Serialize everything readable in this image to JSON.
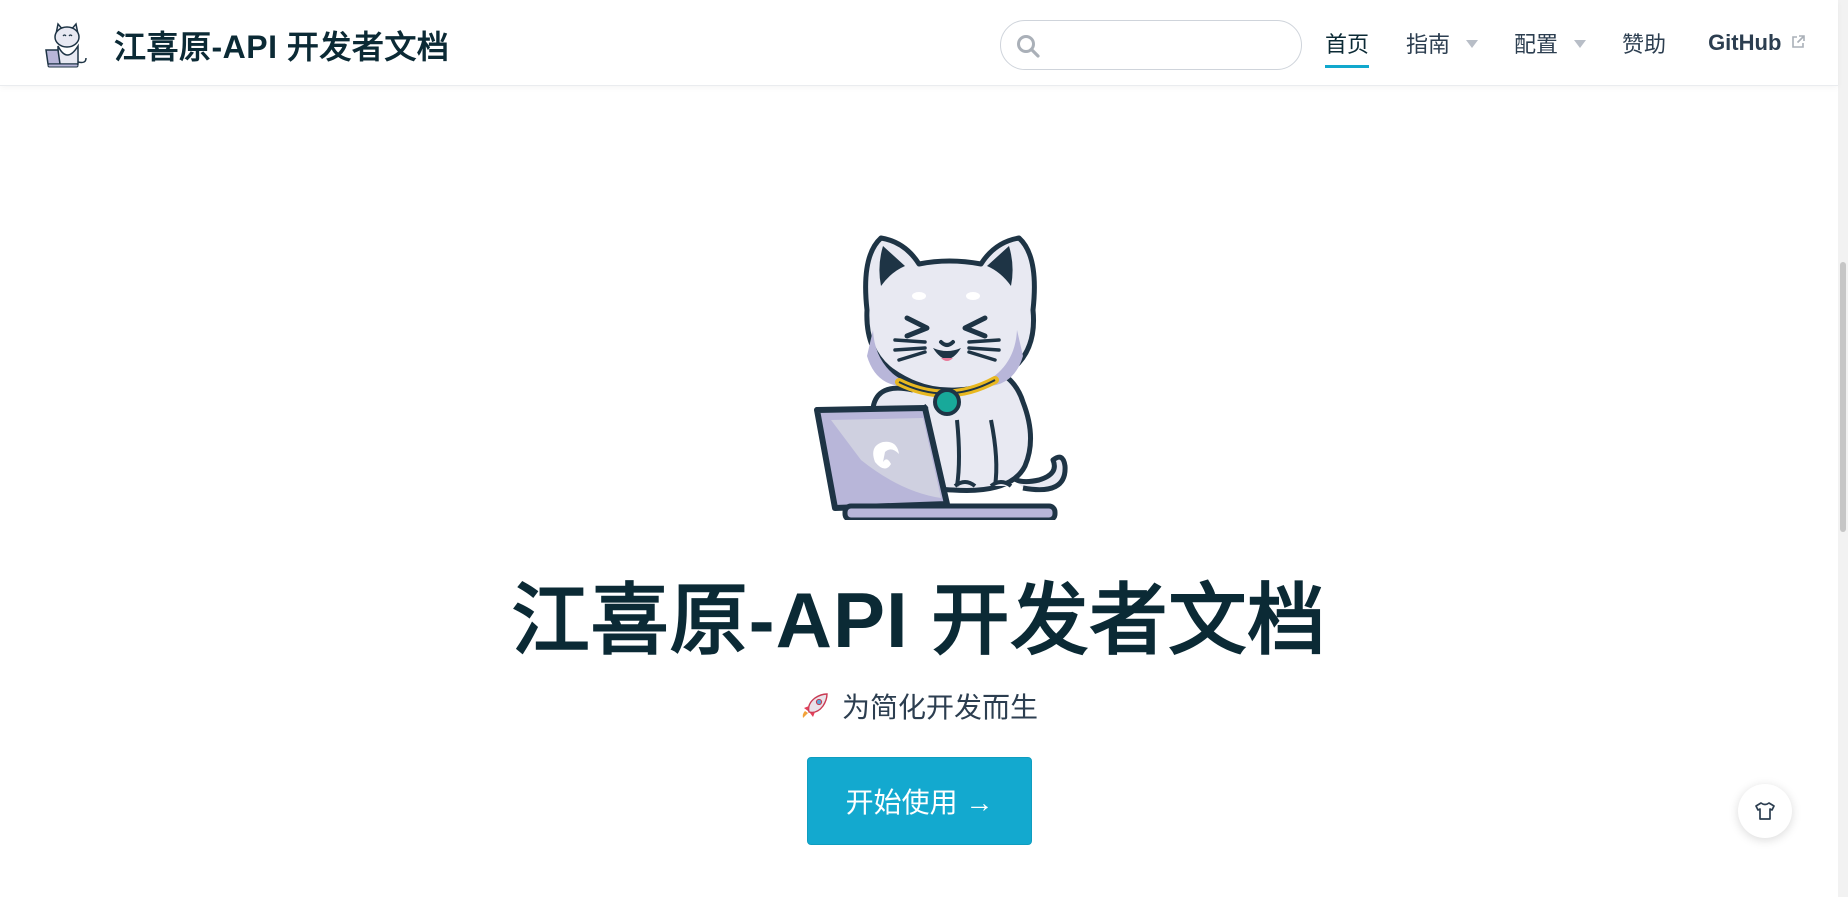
{
  "site": {
    "title": "江喜原-API 开发者文档",
    "logo": "cat-laptop-logo"
  },
  "search": {
    "placeholder": "",
    "value": "",
    "icon": "search-icon"
  },
  "nav": {
    "items": [
      {
        "label": "首页",
        "active": true
      },
      {
        "label": "指南",
        "dropdown": true
      },
      {
        "label": "配置",
        "dropdown": true
      },
      {
        "label": "赞助"
      },
      {
        "label": "GitHub",
        "external": true
      }
    ]
  },
  "hero": {
    "image": "cat-with-laptop-illustration",
    "title": "江喜原-API 开发者文档",
    "tagline": "为简化开发而生",
    "tagline_icon": "rocket-icon",
    "action_label": "开始使用 →"
  },
  "floating": {
    "theme_icon": "shirt-icon"
  },
  "colors": {
    "accent": "#13a9cf",
    "title": "#0b2a35",
    "text": "#2c3e50"
  }
}
